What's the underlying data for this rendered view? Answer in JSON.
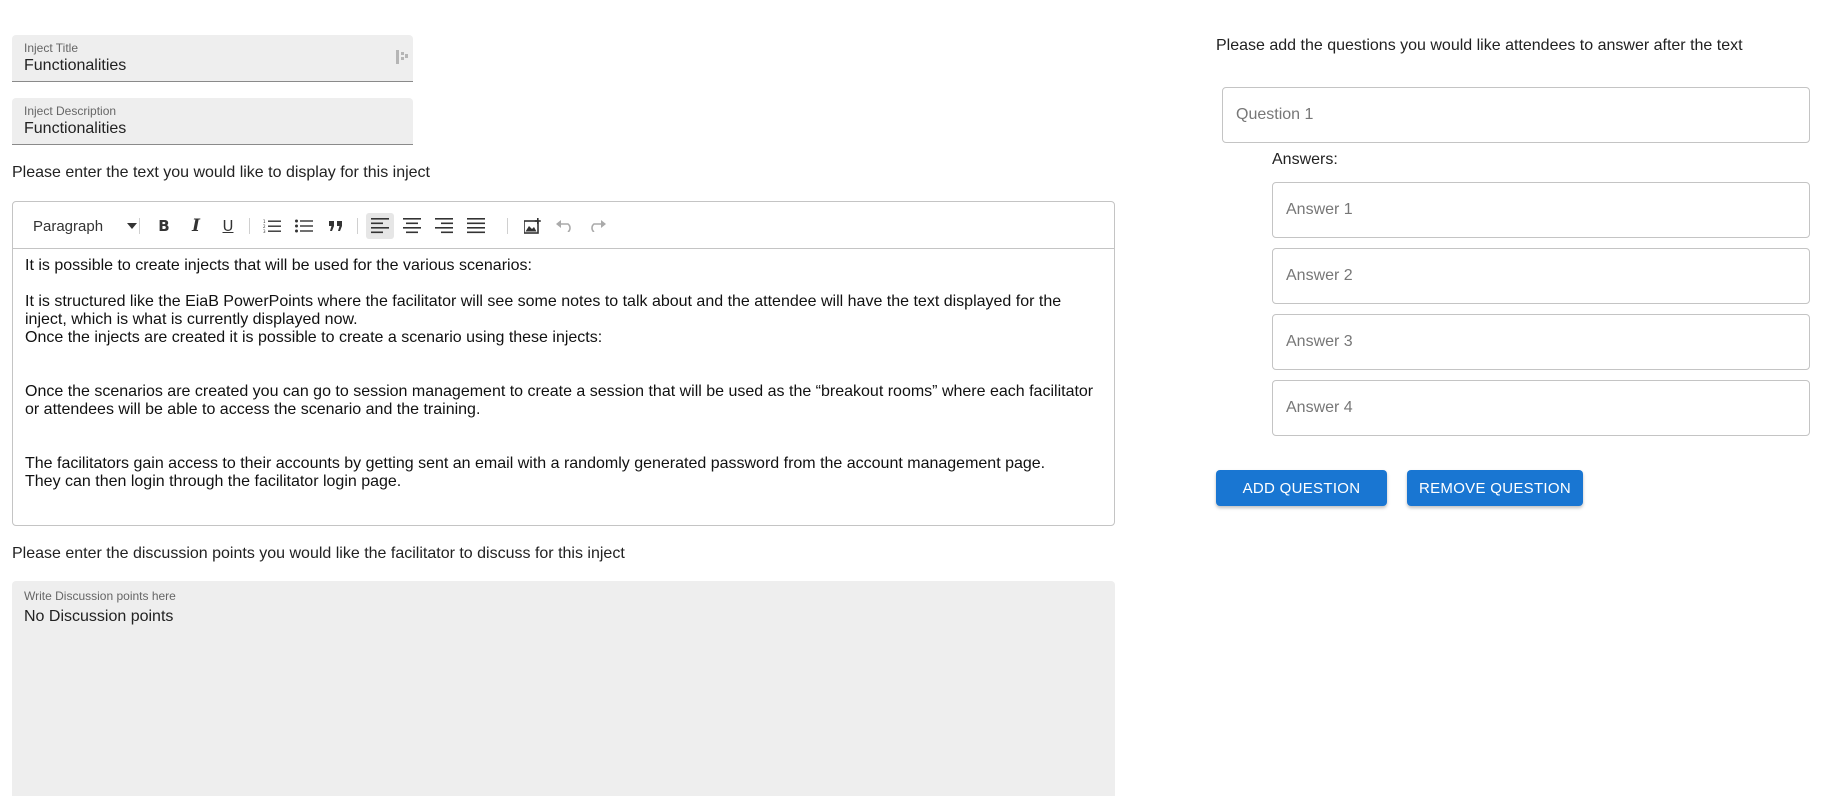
{
  "inject_title": {
    "label": "Inject Title",
    "value": "Functionalities"
  },
  "inject_description": {
    "label": "Inject Description",
    "value": "Functionalities"
  },
  "text_prompt": "Please enter the text you would like to display for this inject",
  "editor": {
    "paragraph_style": "Paragraph",
    "icons": [
      "bold-icon",
      "italic-icon",
      "underline-icon",
      "numbered-list-icon",
      "bulleted-list-icon",
      "blockquote-icon",
      "align-left-icon",
      "align-center-icon",
      "align-right-icon",
      "align-justify-icon",
      "insert-image-icon",
      "undo-icon",
      "redo-icon"
    ],
    "paragraphs": [
      "It is possible to create injects that will be used for the various scenarios:",
      "It is structured like the EiaB PowerPoints where the facilitator will see some notes to talk about and the attendee will have the text displayed for the inject, which is what is currently displayed now.",
      "Once the injects are created it is possible to create a scenario using these injects:",
      "Once the scenarios are created you can go to session management to create a session that will be used as the “breakout rooms” where each facilitator or attendees will be able to access the scenario and the training.",
      "The facilitators gain access to their accounts by getting sent an email with a randomly generated password from the account management page.",
      "They can then login through the facilitator login page."
    ]
  },
  "discussion_prompt": "Please enter the discussion points you would like the facilitator to discuss for this inject",
  "discussion": {
    "label": "Write Discussion points here",
    "value": "No Discussion points"
  },
  "questions_prompt": "Please add the questions you would like attendees to answer after the text",
  "question": {
    "placeholder": "Question 1"
  },
  "answers_label": "Answers:",
  "answers": [
    {
      "placeholder": "Answer 1"
    },
    {
      "placeholder": "Answer 2"
    },
    {
      "placeholder": "Answer 3"
    },
    {
      "placeholder": "Answer 4"
    }
  ],
  "buttons": {
    "add": "ADD QUESTION",
    "remove": "REMOVE QUESTION"
  },
  "colors": {
    "primary": "#1976d2",
    "field_bg": "#eeeeee",
    "border": "#c4c4c4"
  }
}
